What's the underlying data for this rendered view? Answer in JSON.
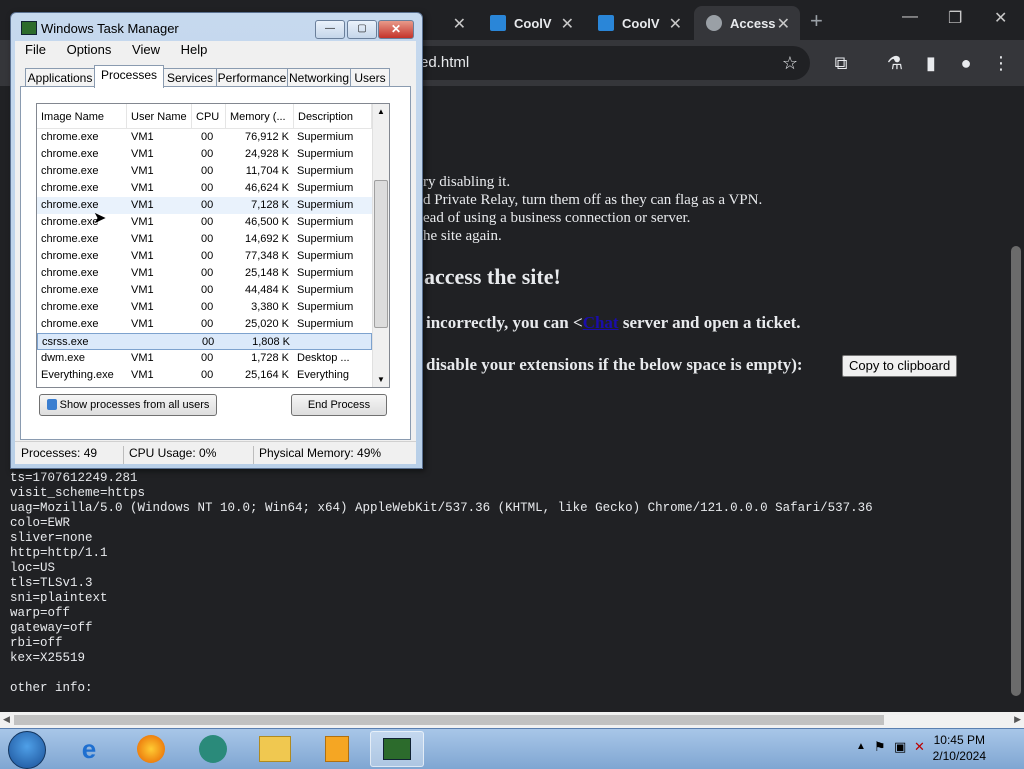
{
  "browser": {
    "tabs": [
      {
        "title": "CoolV",
        "favicon": "monitor-icon"
      },
      {
        "title": "CoolV",
        "favicon": "monitor-icon"
      },
      {
        "title": "Access",
        "favicon": "cloudflare-icon"
      }
    ],
    "address": "ed.html",
    "page": {
      "lines": [
        "ry disabling it.",
        "d Private Relay, turn them off as they can flag as a VPN.",
        "ead of using a business connection or server.",
        "he site again."
      ],
      "heading": "access the site!",
      "help_prefix": "incorrectly, you can <",
      "help_link": "Chat",
      "help_suffix": " server and open a ticket.",
      "ext_text": "disable your extensions if the below space is empty):",
      "copy_button": "Copy to clipboard",
      "trace": "ts=1707612249.281\nvisit_scheme=https\nuag=Mozilla/5.0 (Windows NT 10.0; Win64; x64) AppleWebKit/537.36 (KHTML, like Gecko) Chrome/121.0.0.0 Safari/537.36\ncolo=EWR\nsliver=none\nhttp=http/1.1\nloc=US\ntls=TLSv1.3\nsni=plaintext\nwarp=off\ngateway=off\nrbi=off\nkex=X25519\n\nother info:"
    }
  },
  "taskmanager": {
    "title": "Windows Task Manager",
    "menu": [
      "File",
      "Options",
      "View",
      "Help"
    ],
    "tabs": [
      "Applications",
      "Processes",
      "Services",
      "Performance",
      "Networking",
      "Users"
    ],
    "selected_tab": "Processes",
    "columns": [
      "Image Name",
      "User Name",
      "CPU",
      "Memory (...",
      "Description"
    ],
    "rows": [
      [
        "chrome.exe",
        "VM1",
        "00",
        "76,912 K",
        "Supermium"
      ],
      [
        "chrome.exe",
        "VM1",
        "00",
        "24,928 K",
        "Supermium"
      ],
      [
        "chrome.exe",
        "VM1",
        "00",
        "11,704 K",
        "Supermium"
      ],
      [
        "chrome.exe",
        "VM1",
        "00",
        "46,624 K",
        "Supermium"
      ],
      [
        "chrome.exe",
        "VM1",
        "00",
        "7,128 K",
        "Supermium"
      ],
      [
        "chrome.exe",
        "VM1",
        "00",
        "46,500 K",
        "Supermium"
      ],
      [
        "chrome.exe",
        "VM1",
        "00",
        "14,692 K",
        "Supermium"
      ],
      [
        "chrome.exe",
        "VM1",
        "00",
        "77,348 K",
        "Supermium"
      ],
      [
        "chrome.exe",
        "VM1",
        "00",
        "25,148 K",
        "Supermium"
      ],
      [
        "chrome.exe",
        "VM1",
        "00",
        "44,484 K",
        "Supermium"
      ],
      [
        "chrome.exe",
        "VM1",
        "00",
        "3,380 K",
        "Supermium"
      ],
      [
        "chrome.exe",
        "VM1",
        "00",
        "25,020 K",
        "Supermium"
      ],
      [
        "csrss.exe",
        "",
        "00",
        "1,808 K",
        ""
      ],
      [
        "dwm.exe",
        "VM1",
        "00",
        "1,728 K",
        "Desktop ..."
      ],
      [
        "Everything.exe",
        "VM1",
        "00",
        "25,164 K",
        "Everything"
      ]
    ],
    "selected_row": 12,
    "hover_row": 4,
    "show_all_button": "Show processes from all users",
    "end_process_button": "End Process",
    "status": {
      "processes": "Processes: 49",
      "cpu": "CPU Usage: 0%",
      "memory": "Physical Memory: 49%"
    }
  },
  "taskbar": {
    "apps": [
      "internet-explorer-icon",
      "firefox-icon",
      "app-icon",
      "file-explorer-icon",
      "media-player-icon",
      "task-manager-icon"
    ],
    "time": "10:45 PM",
    "date": "2/10/2024"
  }
}
